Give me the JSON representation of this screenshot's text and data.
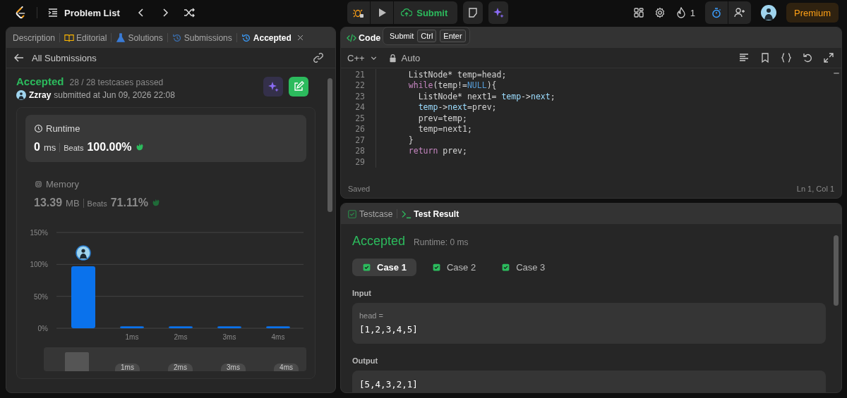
{
  "topbar": {
    "title": "Problem List",
    "submit": "Submit",
    "streak": "1",
    "premium": "Premium"
  },
  "tooltip": {
    "label": "Submit",
    "keys": [
      "Ctrl",
      "Enter"
    ]
  },
  "left_tabs": [
    {
      "label": "Description",
      "selected": false,
      "closable": false
    },
    {
      "label": "Editorial",
      "selected": false,
      "closable": false
    },
    {
      "label": "Solutions",
      "selected": false,
      "closable": false
    },
    {
      "label": "Submissions",
      "selected": false,
      "closable": false
    },
    {
      "label": "Accepted",
      "selected": true,
      "closable": true
    }
  ],
  "back_link": "All Submissions",
  "submission": {
    "status": "Accepted",
    "passed": "28 / 28 testcases passed",
    "user": "Zzray",
    "submitted": "submitted at Jun 09, 2026 22:08"
  },
  "stats": [
    {
      "title": "Runtime",
      "value": "0",
      "unit": "ms",
      "beats_label": "Beats",
      "beats": "100.00%",
      "selected": true
    },
    {
      "title": "Memory",
      "value": "13.39",
      "unit": "MB",
      "beats_label": "Beats",
      "beats": "71.11%",
      "selected": false
    }
  ],
  "chart_data": {
    "type": "bar",
    "categories": [
      null,
      "1ms",
      "2ms",
      "3ms",
      "4ms"
    ],
    "values": [
      97,
      3,
      3,
      3,
      3
    ],
    "ylim": [
      0,
      150
    ],
    "yticks": [
      {
        "value": 0,
        "label": "0%"
      },
      {
        "value": 50,
        "label": "50%"
      },
      {
        "value": 100,
        "label": "100%"
      },
      {
        "value": 150,
        "label": "150%"
      }
    ]
  },
  "brush_labels": [
    "1ms",
    "2ms",
    "3ms",
    "4ms"
  ],
  "editor": {
    "tab": "Code",
    "language": "C++",
    "mode": "Auto",
    "status": "Saved",
    "cursor": "Ln 1, Col 1",
    "lines": [
      {
        "number": "21",
        "tokens": [
          {
            "text": "  ListNode* temp=head;",
            "kind": "plain"
          }
        ]
      },
      {
        "number": "22",
        "tokens": [
          {
            "text": "  while",
            "kind": "keyword"
          },
          {
            "text": "(temp!=",
            "kind": "plain"
          },
          {
            "text": "NULL",
            "kind": "constant"
          },
          {
            "text": "){",
            "kind": "plain"
          }
        ]
      },
      {
        "number": "23",
        "tokens": [
          {
            "text": "    ListNode* next1= ",
            "kind": "plain"
          },
          {
            "text": "temp",
            "kind": "member"
          },
          {
            "text": "->",
            "kind": "plain"
          },
          {
            "text": "next",
            "kind": "member"
          },
          {
            "text": ";",
            "kind": "plain"
          }
        ]
      },
      {
        "number": "24",
        "tokens": [
          {
            "text": "    temp",
            "kind": "member"
          },
          {
            "text": "->",
            "kind": "plain"
          },
          {
            "text": "next",
            "kind": "member"
          },
          {
            "text": "=prev;",
            "kind": "plain"
          }
        ]
      },
      {
        "number": "25",
        "tokens": [
          {
            "text": "    prev=temp;",
            "kind": "plain"
          }
        ]
      },
      {
        "number": "26",
        "tokens": [
          {
            "text": "    temp=next1;",
            "kind": "plain"
          }
        ]
      },
      {
        "number": "27",
        "tokens": [
          {
            "text": "  }",
            "kind": "plain"
          }
        ]
      },
      {
        "number": "28",
        "tokens": [
          {
            "text": "  return",
            "kind": "keyword"
          },
          {
            "text": " prev;",
            "kind": "plain"
          }
        ]
      },
      {
        "number": "29"
      }
    ]
  },
  "result_tabs": [
    {
      "label": "Testcase",
      "selected": false
    },
    {
      "label": "Test Result",
      "selected": true
    }
  ],
  "result": {
    "status": "Accepted",
    "runtime": "Runtime: 0 ms",
    "cases": [
      {
        "label": "Case 1",
        "selected": true,
        "passed": true
      },
      {
        "label": "Case 2",
        "selected": false,
        "passed": true
      },
      {
        "label": "Case 3",
        "selected": false,
        "passed": true
      }
    ],
    "input_label": "Input",
    "input_name": "head =",
    "input_value": "[1,2,3,4,5]",
    "output_label": "Output",
    "output_value": "[5,4,3,2,1]"
  }
}
